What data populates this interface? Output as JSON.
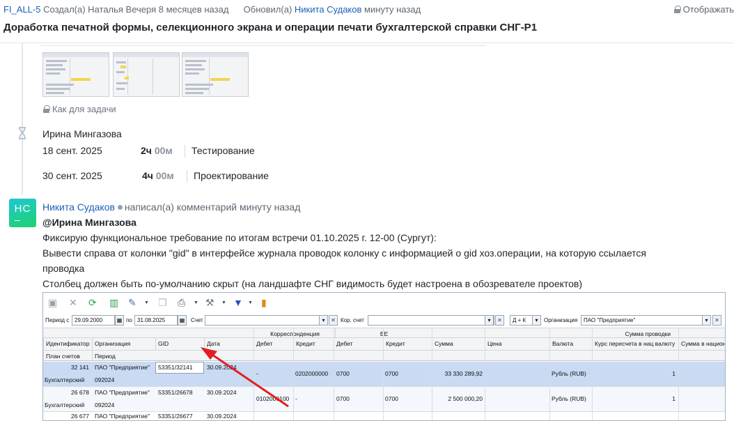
{
  "header": {
    "issue_key": "FI_ALL-5",
    "created_label": "Создал(а)",
    "created_by": "Наталья Вечеря",
    "created_when": "8 месяцев назад",
    "updated_label": "Обновил(а)",
    "updated_by": "Никита Судаков",
    "updated_when": "минуту назад",
    "display_label": "Отображать",
    "title": "Доработка печатной формы, селекционного экрана и операции печати бухгалтерской справки СНГ-Р1"
  },
  "attachments": {
    "visibility": "Как для задачи"
  },
  "worklog": {
    "user": "Ирина Мингазова",
    "entries": [
      {
        "date": "18 сент. 2025",
        "hours": "2ч",
        "minutes": "00м",
        "activity": "Тестирование"
      },
      {
        "date": "30 сент. 2025",
        "hours": "4ч",
        "minutes": "00м",
        "activity": "Проектирование"
      }
    ]
  },
  "comment": {
    "avatar_initials": "НС",
    "author": "Никита Судаков",
    "action": "написал(а) комментарий",
    "when": "минуту назад",
    "mention": "@Ирина Мингазова",
    "lines": [
      "Фиксирую функциональное требование по итогам встречи 01.10.2025 г. 12-00 (Сургут):",
      "Вывести справа от колонки \"gid\" в интерфейсе журнала проводок колонку с информацией о gid хоз.операции, на которую ссылается",
      "проводка",
      "Столбец должен быть по-умолчанию скрыт (на ландшафте СНГ видимость будет настроена в обозревателе проектов)"
    ]
  },
  "grid": {
    "filters": {
      "period_from_label": "Период с",
      "period_from": "29.09.2000",
      "period_to_label": "по",
      "period_to": "31.08.2025",
      "account_label": "Счет",
      "corr_account_label": "Кор. счет",
      "dk_value": "Д + К",
      "org_label": "Организация",
      "org_value": "ПАО \"Предприятие\""
    },
    "group_headers": {
      "correspondence": "Корреспонденция",
      "be": "БЕ",
      "amounts": "Сумма проводки"
    },
    "columns": [
      "Идентификатор",
      "Организация",
      "GID",
      "Дата",
      "Дебет",
      "Кредит",
      "Дебет",
      "Кредит",
      "Сумма",
      "Цена",
      "Валюта",
      "Курс пересчета в нац валюту",
      "Сумма в национа"
    ],
    "subcolumns": [
      "План счетов",
      "Период"
    ],
    "rows": [
      {
        "id": "32 141",
        "org": "ПАО \"Предприятие\"",
        "gid": "53351/32141",
        "date": "30.09.2024",
        "corr_debit": "-",
        "corr_credit": "0202000000",
        "be_debit": "0700",
        "be_credit": "0700",
        "sum": "33 330 289,92",
        "price": "",
        "currency": "Рубль (RUB)",
        "rate": "1",
        "plan": "Бухгалтерский",
        "period": "092024"
      },
      {
        "id": "26 678",
        "org": "ПАО \"Предприятие\"",
        "gid": "53351/26678",
        "date": "30.09.2024",
        "corr_debit": "0102000100",
        "corr_credit": "-",
        "be_debit": "0700",
        "be_credit": "0700",
        "sum": "2 500 000,20",
        "price": "",
        "currency": "Рубль (RUB)",
        "rate": "1",
        "plan": "Бухгалтерский",
        "period": "092024"
      },
      {
        "id": "26 677",
        "org": "ПАО \"Предприятие\"",
        "gid": "53351/26677",
        "date": "30.09.2024"
      }
    ]
  },
  "colors": {
    "link": "#1d5fb8",
    "arrow": "#e02020",
    "selected_row": "#c9daf2"
  }
}
